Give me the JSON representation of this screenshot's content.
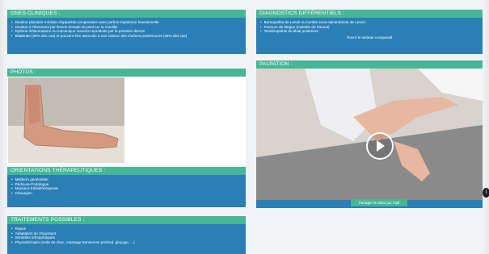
{
  "signes_cliniques": {
    "title": "GNES CLINIQUES :",
    "items": [
      "Douleur plantaire médiale d'apparition progressive avec parfois impotence fonctionnelle",
      "Douleur à l'étirement par flexion dorsale du pied sur la cheville",
      "Rythme inflammatoire ou mécanique souvent reproduite par la pression directe",
      "Bilatérale (30% des cas) et pouvant être associée à une raideur des chaînes postérieures (36% des cas)"
    ]
  },
  "diagnostics": {
    "title": "DIAGNOSTICS DIFFÉRENTIELS :",
    "items": [
      "Bursopathie de Lenoir ou bursite sous-calcanéenne de Lenoir",
      "Fracture de fatigue (maladie de Pauzat)",
      "Tendinopathie du tibial postérieur"
    ],
    "link": "Ouvrir le tableau comparatif"
  },
  "photos": {
    "title": "PHOTOS :"
  },
  "palpation": {
    "title": "PALPATION :",
    "share_label": "Partager la vidéo par mail"
  },
  "orientations": {
    "title": "ORIENTATIONS THÉRAPEUTIQUES :",
    "items": [
      "Médecin généraliste",
      "Pédicure-Podologue",
      "Masseur-Kinésithérapeute",
      "Chirurgien"
    ]
  },
  "traitements": {
    "title": "TRAITEMENTS POSSIBLES :",
    "items": [
      "Repos",
      "Adaptation du chaussant",
      "Semelles orthopédiques",
      "Physiothérapie (onde de choc, massage transverse profond, glaçage, ...)"
    ]
  },
  "colors": {
    "panel": "#2a7fb6",
    "header": "#45b797"
  }
}
